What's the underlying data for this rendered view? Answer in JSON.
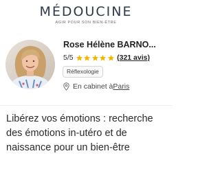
{
  "header": {
    "logo_pre": "M",
    "logo_accent": "É",
    "logo_post": "DOUCINE",
    "tagline": "AGIR POUR SON BIEN-ÊTRE"
  },
  "profile": {
    "name": "Rose Hélène BARNO...",
    "rating_score": "5/5",
    "stars_filled": 5,
    "reviews_label": "(321 avis)",
    "specialty": "Réflexologie",
    "location_prefix": "En cabinet à ",
    "location_city": "Paris",
    "colors": {
      "star": "#f5b400",
      "accent": "#2c3a4a"
    }
  },
  "session": {
    "headline": "Libérez vos émotions : recherche des émotions in-utéro et de naissance pour un bien-être"
  }
}
